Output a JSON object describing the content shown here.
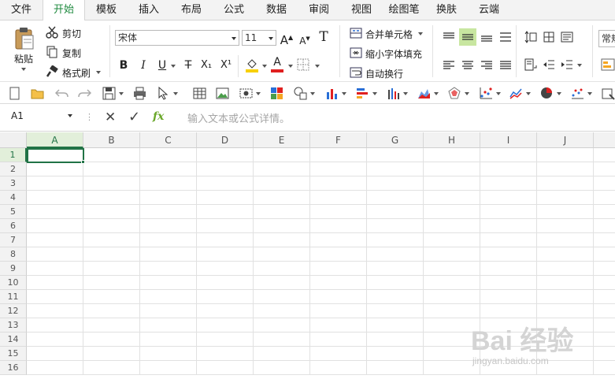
{
  "menu": {
    "tabs": [
      {
        "label": "文件",
        "active": false
      },
      {
        "label": "开始",
        "active": true
      },
      {
        "label": "模板",
        "active": false
      },
      {
        "label": "插入",
        "active": false
      },
      {
        "label": "布局",
        "active": false
      },
      {
        "label": "公式",
        "active": false
      },
      {
        "label": "数据",
        "active": false
      },
      {
        "label": "审阅",
        "active": false
      },
      {
        "label": "视图",
        "active": false
      },
      {
        "label": "绘图笔",
        "active": false
      },
      {
        "label": "换肤",
        "active": false
      },
      {
        "label": "云端",
        "active": false
      }
    ]
  },
  "ribbon": {
    "paste_label": "粘贴",
    "cut_label": "剪切",
    "copy_label": "复制",
    "format_painter_label": "格式刷",
    "font_name": "宋体",
    "font_size": "11",
    "grow_font": "A",
    "shrink_font": "A",
    "clear_format": "T",
    "bold": "B",
    "italic": "I",
    "underline": "U",
    "strikethrough": "T",
    "subscript": "X₁",
    "superscript": "X¹",
    "font_color_letter": "A",
    "merge_label": "合并单元格",
    "shrink_fit_label": "缩小字体填充",
    "wrap_label": "自动换行",
    "style_label": "常规",
    "colors": {
      "accent": "#217346",
      "tab_active": "#1f8a3f",
      "highlight_yellow": "#f7d000",
      "font_red": "#e02020",
      "align_selected_bg": "#c8e6a0"
    }
  },
  "formula_bar": {
    "name_box": "A1",
    "cancel_icon": "✕",
    "confirm_icon": "✓",
    "fx_label": "fx",
    "placeholder": "输入文本或公式详情。"
  },
  "sheet": {
    "columns": [
      "A",
      "B",
      "C",
      "D",
      "E",
      "F",
      "G",
      "H",
      "I",
      "J"
    ],
    "rows": [
      "1",
      "2",
      "3",
      "4",
      "5",
      "6",
      "7",
      "8",
      "9",
      "10",
      "11",
      "12",
      "13",
      "14",
      "15",
      "16"
    ],
    "active_cell": "A1"
  },
  "watermark": {
    "brand": "Bai 经验",
    "url": "jingyan.baidu.com"
  }
}
